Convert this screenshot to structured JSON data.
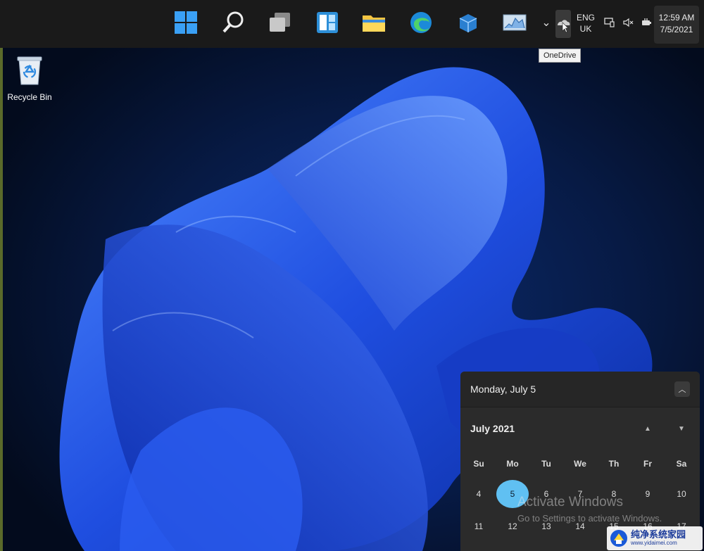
{
  "taskbar": {
    "apps": [
      {
        "name": "Start",
        "icon": "windows-logo-icon"
      },
      {
        "name": "Search",
        "icon": "search-icon"
      },
      {
        "name": "Task View",
        "icon": "task-view-icon"
      },
      {
        "name": "Widgets",
        "icon": "widgets-icon"
      },
      {
        "name": "File Explorer",
        "icon": "folder-icon"
      },
      {
        "name": "Microsoft Edge",
        "icon": "edge-icon"
      },
      {
        "name": "Store",
        "icon": "store-icon"
      },
      {
        "name": "Performance Monitor",
        "icon": "monitor-icon"
      }
    ],
    "language_line1": "ENG",
    "language_line2": "UK",
    "time": "12:59 AM",
    "date": "7/5/2021",
    "tooltip": "OneDrive"
  },
  "desktop": {
    "recycle_bin_label": "Recycle Bin"
  },
  "calendar": {
    "header_date": "Monday, July 5",
    "month_label": "July 2021",
    "weekdays": [
      "Su",
      "Mo",
      "Tu",
      "We",
      "Th",
      "Fr",
      "Sa"
    ],
    "rows": [
      [
        "4",
        "5",
        "6",
        "7",
        "8",
        "9",
        "10"
      ],
      [
        "11",
        "12",
        "13",
        "14",
        "15",
        "16",
        "17"
      ]
    ],
    "today": "5"
  },
  "watermark": {
    "title": "Activate Windows",
    "subtitle": "Go to Settings to activate Windows."
  },
  "brand": {
    "name": "纯净系统家园",
    "url": "www.yidaimei.com"
  },
  "colors": {
    "taskbar": "#1a1a1a",
    "accent": "#60c0f2",
    "flyout": "#2b2b2b"
  }
}
